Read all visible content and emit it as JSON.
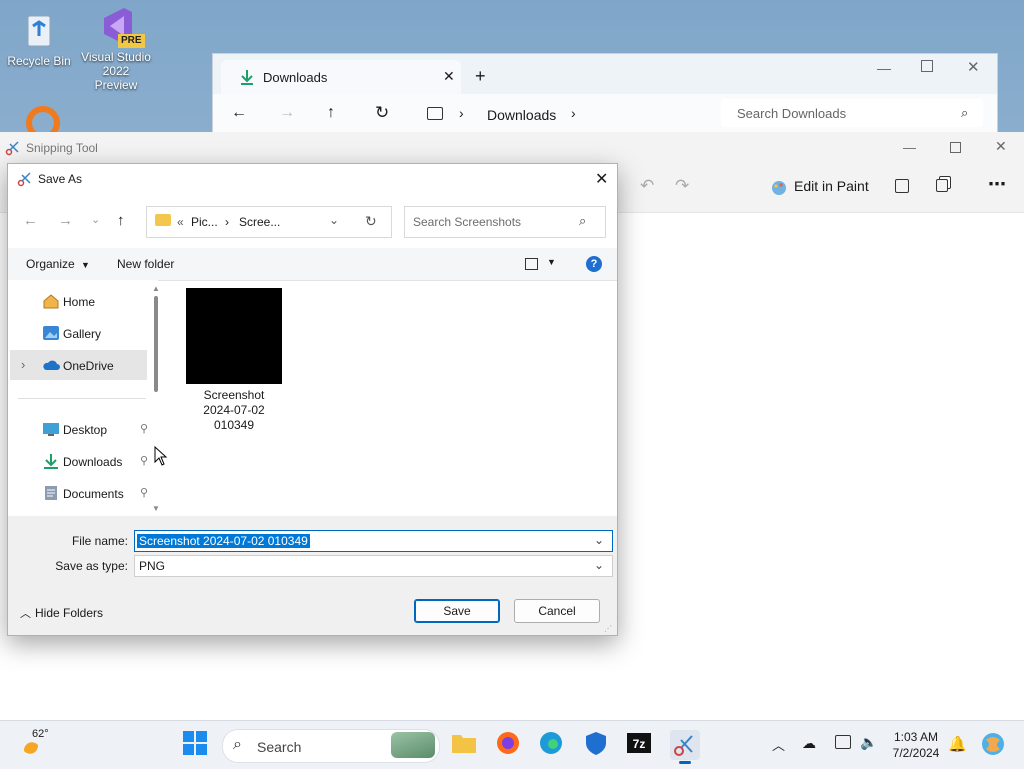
{
  "desktop": {
    "icons": [
      {
        "label": "Recycle Bin"
      },
      {
        "label": "Visual Studio 2022 Preview",
        "badge": "PRE"
      }
    ]
  },
  "explorer": {
    "tab_title": "Downloads",
    "address": "Downloads",
    "search_placeholder": "Search Downloads"
  },
  "snipping_tool": {
    "title": "Snipping Tool",
    "edit_in_paint": "Edit in Paint"
  },
  "save_dialog": {
    "title": "Save As",
    "breadcrumb": [
      "Pic...",
      "Scree..."
    ],
    "search_placeholder": "Search Screenshots",
    "organize": "Organize",
    "new_folder": "New folder",
    "nav_items": [
      {
        "label": "Home",
        "icon": "home-icon"
      },
      {
        "label": "Gallery",
        "icon": "gallery-icon"
      },
      {
        "label": "OneDrive",
        "icon": "cloud-icon"
      },
      {
        "label": "Desktop",
        "icon": "desktop-icon"
      },
      {
        "label": "Downloads",
        "icon": "download-icon"
      },
      {
        "label": "Documents",
        "icon": "document-icon"
      }
    ],
    "file": {
      "label_line1": "Screenshot",
      "label_line2": "2024-07-02",
      "label_line3": "010349"
    },
    "file_name_label": "File name:",
    "file_name_value": "Screenshot 2024-07-02 010349",
    "save_as_type_label": "Save as type:",
    "save_as_type_value": "PNG",
    "hide_folders": "Hide Folders",
    "save": "Save",
    "cancel": "Cancel"
  },
  "taskbar": {
    "weather_temp": "62°",
    "search_placeholder": "Search",
    "time": "1:03 AM",
    "date": "7/2/2024"
  },
  "colors": {
    "accent": "#0067c0",
    "selection": "#0078d7"
  }
}
